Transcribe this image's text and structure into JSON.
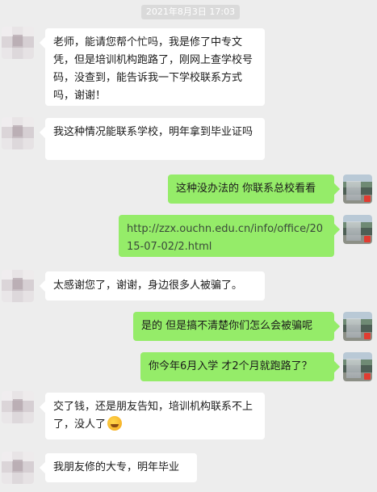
{
  "timestamp": "2021年8月3日 17:03",
  "colors": {
    "background": "#ededed",
    "incoming_bubble": "#ffffff",
    "outgoing_bubble": "#95ec69"
  },
  "messages": [
    {
      "side": "left",
      "text": "老师，能请您帮个忙吗，我是修了中专文凭，但是培训机构跑路了，刚网上查学校号码，没查到，能告诉我一下学校联系方式吗，谢谢！"
    },
    {
      "side": "left",
      "text": "我这种情况能联系学校，明年拿到毕业证吗"
    },
    {
      "side": "right",
      "text": "这种没办法的 你联系总校看看"
    },
    {
      "side": "right",
      "text": "http://zzx.ouchn.edu.cn/info/office/2015-07-02/2.html"
    },
    {
      "side": "left",
      "text": "太感谢您了，谢谢，身边很多人被骗了。"
    },
    {
      "side": "right",
      "text": "是的 但是搞不清楚你们怎么会被骗呢"
    },
    {
      "side": "right",
      "text": "你今年6月入学 才2个月就跑路了？"
    },
    {
      "side": "left",
      "text": "交了钱，还是朋友告知，培训机构联系不上了，没人了",
      "emoji": "facepalm-emoji"
    },
    {
      "side": "left",
      "text": "我朋友修的大专，明年毕业"
    }
  ]
}
